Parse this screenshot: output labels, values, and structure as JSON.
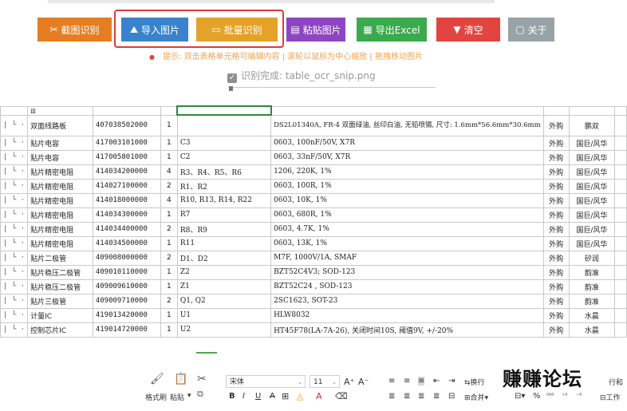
{
  "toolbar": {
    "snip_label": "截图识别",
    "import_label": "导入图片",
    "batch_label": "批量识别",
    "paste_label": "粘贴图片",
    "export_label": "导出Excel",
    "clear_label": "清空",
    "about_label": "关于",
    "tip": "提示: 双击表格单元格可编辑内容 | 滚轮以鼠标为中心缩放 | 拖拽移动图片",
    "status": "识别完成: table_ocr_snip.png"
  },
  "colors": {
    "snip": "#e57e22",
    "import": "#3a82cc",
    "batch": "#e4a228",
    "paste": "#8e45c2",
    "export": "#3aaa4c",
    "clear": "#e24540",
    "about": "#98a3a8",
    "highlight_box": "#e13a3a"
  },
  "icons": [
    "scissors-icon",
    "upload-image-icon",
    "frame-icon",
    "clipboard-icon",
    "excel-icon",
    "trash-icon",
    "info-icon",
    "check-icon"
  ],
  "sheet": {
    "partial_first_cell": "Ⅲ",
    "rows": [
      {
        "prefix": "| └ ·",
        "name": "双面线路板",
        "code": "407038502000",
        "qty": "1",
        "ref": "",
        "spec": "DS2L01340A, FR-4 双面绿油, 丝印白油, 无铅喷锡, 尺寸: 1.6mm*56.6mm*30.6mm",
        "src": "外购",
        "maker": "鹏双"
      },
      {
        "prefix": "| └ ·",
        "name": "贴片电容",
        "code": "417003101000",
        "qty": "1",
        "ref": "C3",
        "spec": "0603, 100nF/50V, X7R",
        "src": "外购",
        "maker": "国巨/风华"
      },
      {
        "prefix": "| └ ·",
        "name": "贴片电容",
        "code": "417005801000",
        "qty": "1",
        "ref": "C2",
        "spec": "0603, 33nF/50V, X7R",
        "src": "外购",
        "maker": "国巨/风华"
      },
      {
        "prefix": "| └ ·",
        "name": "贴片精密电阻",
        "code": "414034200000",
        "qty": "4",
        "ref": "R3、R4、R5、R6",
        "spec": "1206, 220K, 1%",
        "src": "外购",
        "maker": "国巨/风华"
      },
      {
        "prefix": "| └ ·",
        "name": "贴片精密电阻",
        "code": "414027100000",
        "qty": "2",
        "ref": "R1、R2",
        "spec": "0603, 100R, 1%",
        "src": "外购",
        "maker": "国巨/风华"
      },
      {
        "prefix": "| └ ·",
        "name": "贴片精密电阻",
        "code": "414018000000",
        "qty": "4",
        "ref": "R10, R13, R14, R22",
        "spec": "0603, 10K, 1%",
        "src": "外购",
        "maker": "国巨/风华"
      },
      {
        "prefix": "| └ ·",
        "name": "贴片精密电阻",
        "code": "414034300000",
        "qty": "1",
        "ref": "R7",
        "spec": "0603, 680R, 1%",
        "src": "外购",
        "maker": "国巨/风华"
      },
      {
        "prefix": "| └ ·",
        "name": "贴片精密电阻",
        "code": "414034400000",
        "qty": "2",
        "ref": "R8、R9",
        "spec": "0603, 4.7K, 1%",
        "src": "外购",
        "maker": "国巨/风华"
      },
      {
        "prefix": "| └ ·",
        "name": "贴片精密电阻",
        "code": "414034500000",
        "qty": "1",
        "ref": "R11",
        "spec": "0603, 13K, 1%",
        "src": "外购",
        "maker": "国巨/风华"
      },
      {
        "prefix": "| └ ·",
        "name": "贴片二极管",
        "code": "409008000000",
        "qty": "2",
        "ref": "D1、D2",
        "spec": "M7F, 1000V/1A, SMAF",
        "src": "外购",
        "maker": "矽润"
      },
      {
        "prefix": "| └ ·",
        "name": "贴片稳压二极管",
        "code": "409010110000",
        "qty": "1",
        "ref": "Z2",
        "spec": "BZT52C4V3; SOD-123",
        "src": "外购",
        "maker": "韵准"
      },
      {
        "prefix": "| └ ·",
        "name": "贴片稳压二极管",
        "code": "409009610000",
        "qty": "1",
        "ref": "Z1",
        "spec": "BZT52C24 , SOD-123",
        "src": "外购",
        "maker": "韵准"
      },
      {
        "prefix": "| └ ·",
        "name": "贴片三极管",
        "code": "409009710000",
        "qty": "2",
        "ref": "Q1, Q2",
        "spec": "2SC1623, SOT-23",
        "src": "外购",
        "maker": "韵准"
      },
      {
        "prefix": "| └ ·",
        "name": "计量IC",
        "code": "419013420000",
        "qty": "1",
        "ref": "U1",
        "spec": "HLW8032",
        "src": "外购",
        "maker": "水晨"
      },
      {
        "prefix": "| └ ·",
        "name": "控制芯片IC",
        "code": "419014720000",
        "qty": "1",
        "ref": "U2",
        "spec": "HT45F78(LA-7A-26), 关闭时间10S, 阈值9V, +/-20%",
        "src": "外购",
        "maker": "水晨"
      }
    ]
  },
  "ribbon": {
    "format_painter": "格式刷",
    "paste": "粘贴",
    "font_name": "宋体",
    "font_size": "11",
    "wrap": "换行",
    "merge": "合并",
    "watermark": "赚赚论坛",
    "wrap_right": "行和",
    "worksheet": "工作"
  }
}
